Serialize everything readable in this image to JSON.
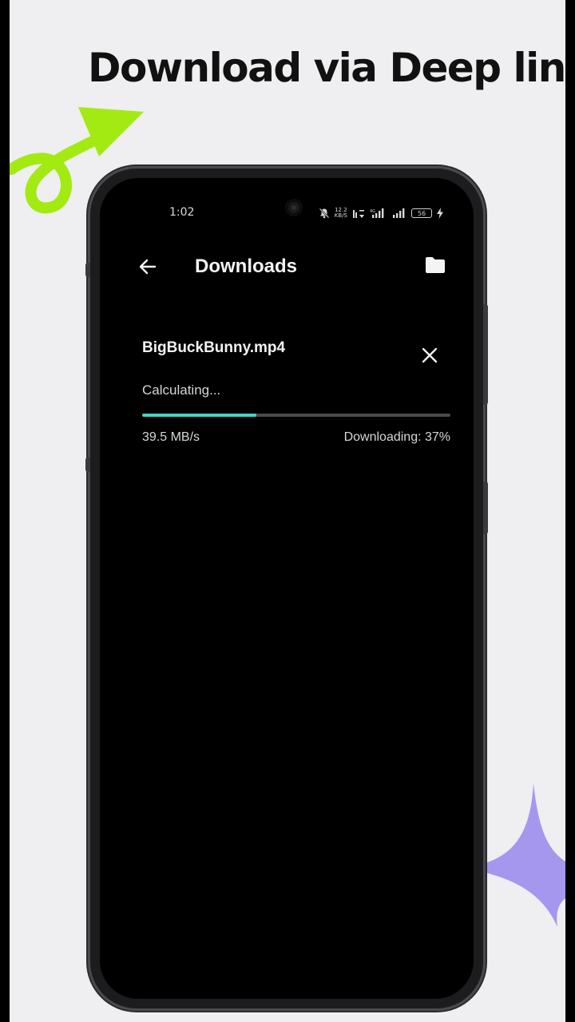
{
  "promo": {
    "headline": "Download via Deep link",
    "arrow_color": "#a3ea12",
    "star_color": "#a597ee"
  },
  "status_bar": {
    "time": "1:02",
    "net_speed_top": "12.2",
    "net_speed_bottom": "KB/S",
    "battery": "56",
    "icons": [
      "mute-icon",
      "net-speed",
      "wifi-calling-icon",
      "signal-icon",
      "signal-icon",
      "battery-icon",
      "charging-icon"
    ]
  },
  "app_bar": {
    "title": "Downloads",
    "back_icon": "arrow-left-icon",
    "folder_icon": "folder-icon"
  },
  "download": {
    "filename": "BigBuckBunny.mp4",
    "status": "Calculating...",
    "speed": "39.5 MB/s",
    "progress_label": "Downloading: 37%",
    "progress_fraction": 0.37,
    "accent_color": "#3fd6c8",
    "cancel_icon": "close-icon"
  }
}
